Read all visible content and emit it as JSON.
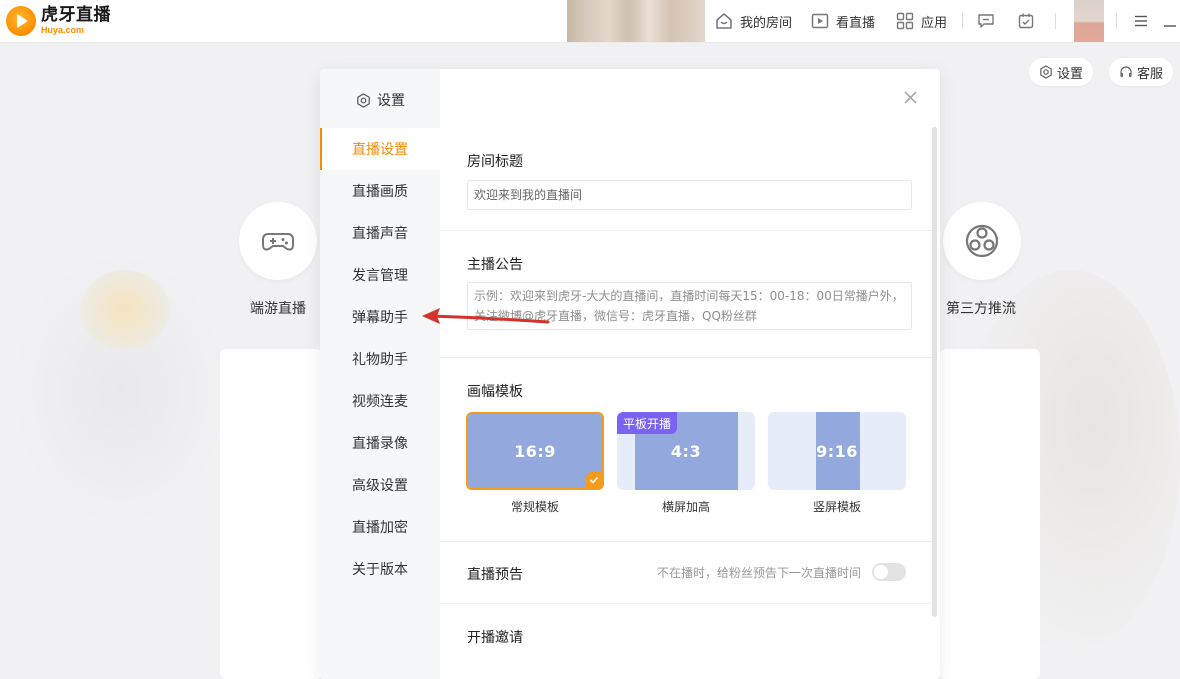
{
  "brand": {
    "name_cn": "虎牙直播",
    "name_en": "Huya.com",
    "accent": "#f58b00"
  },
  "topnav": {
    "my_room": "我的房间",
    "watch_live": "看直播",
    "apps": "应用"
  },
  "background": {
    "settings_btn": "设置",
    "service_btn": "客服",
    "left_mode": "端游直播",
    "right_mode": "第三方推流"
  },
  "settings": {
    "title": "设置",
    "menu": [
      "直播设置",
      "直播画质",
      "直播声音",
      "发言管理",
      "弹幕助手",
      "礼物助手",
      "视频连麦",
      "直播录像",
      "高级设置",
      "直播加密",
      "关于版本"
    ],
    "active_index": 0,
    "room_title": {
      "label": "房间标题",
      "value": "欢迎来到我的直播间"
    },
    "announcement": {
      "label": "主播公告",
      "placeholder": "示例：欢迎来到虎牙-大大的直播间，直播时间每天15：00-18：00日常播户外，关注微博@虎牙直播，微信号：虎牙直播，QQ粉丝群"
    },
    "templates": {
      "label": "画幅模板",
      "items": [
        {
          "ratio": "16:9",
          "name": "常规模板",
          "selected": true
        },
        {
          "ratio": "4:3",
          "name": "横屏加高",
          "badge": "平板开播"
        },
        {
          "ratio": "9:16",
          "name": "竖屏模板"
        }
      ]
    },
    "preview": {
      "label": "直播预告",
      "hint": "不在播时，给粉丝预告下一次直播时间",
      "enabled": false
    },
    "invite": {
      "label": "开播邀请"
    }
  }
}
